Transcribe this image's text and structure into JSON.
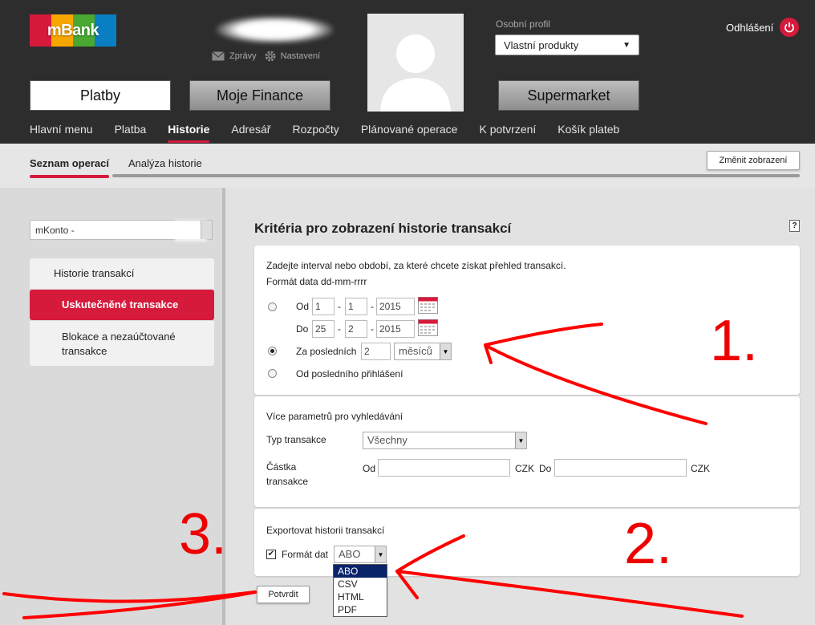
{
  "header": {
    "logo": "mBank",
    "username": "xxxxxxxx",
    "links": [
      {
        "label": "Zprávy",
        "icon": "envelope-icon"
      },
      {
        "label": "Nastavení",
        "icon": "gear-icon"
      }
    ],
    "profile_label": "Osobní profil",
    "profile_value": "Vlastní produkty",
    "logout": "Odhlášení",
    "main_buttons": [
      "Platby",
      "Moje Finance",
      "Supermarket"
    ],
    "nav": [
      "Hlavní menu",
      "Platba",
      "Historie",
      "Adresář",
      "Rozpočty",
      "Plánované operace",
      "K potvrzení",
      "Košík plateb"
    ],
    "active_nav": "Historie",
    "colors": {
      "accent": "#d51a3c",
      "header_bg": "#2d2d2d"
    }
  },
  "subnav": {
    "tabs": [
      "Seznam operací",
      "Analýza historie"
    ],
    "change_view": "Změnit zobrazení"
  },
  "sidebar": {
    "account": "mKonto -",
    "items": [
      "Historie transakcí",
      "Uskutečněné transakce",
      "Blokace a nezaúčtované transakce"
    ]
  },
  "main": {
    "title": "Kritéria pro zobrazení historie transakcí",
    "help": "?",
    "interval_intro": "Zadejte interval nebo období, za které chcete získat přehled transakcí.",
    "date_format": "Formát data dd-mm-rrrr",
    "from_label": "Od",
    "to_label": "Do",
    "from_date": {
      "d": "1",
      "m": "1",
      "y": "2015"
    },
    "to_date": {
      "d": "25",
      "m": "2",
      "y": "2015"
    },
    "last_label": "Za posledních",
    "last_value": "2",
    "last_unit": "měsíců",
    "since_login": "Od posledního přihlášení",
    "more_params": "Více parametrů pro vyhledávání",
    "type_label": "Typ transakce",
    "type_value": "Všechny",
    "amount_label_1": "Částka",
    "amount_label_2": "transakce",
    "amount_from": "Od",
    "amount_to": "Do",
    "currency": "CZK",
    "export_title": "Exportovat historii transakcí",
    "format_label": "Formát dat",
    "format_value": "ABO",
    "format_options": [
      "ABO",
      "CSV",
      "HTML",
      "PDF"
    ],
    "submit": "Potvrdit"
  },
  "annotations": [
    "1.",
    "2.",
    "3."
  ]
}
